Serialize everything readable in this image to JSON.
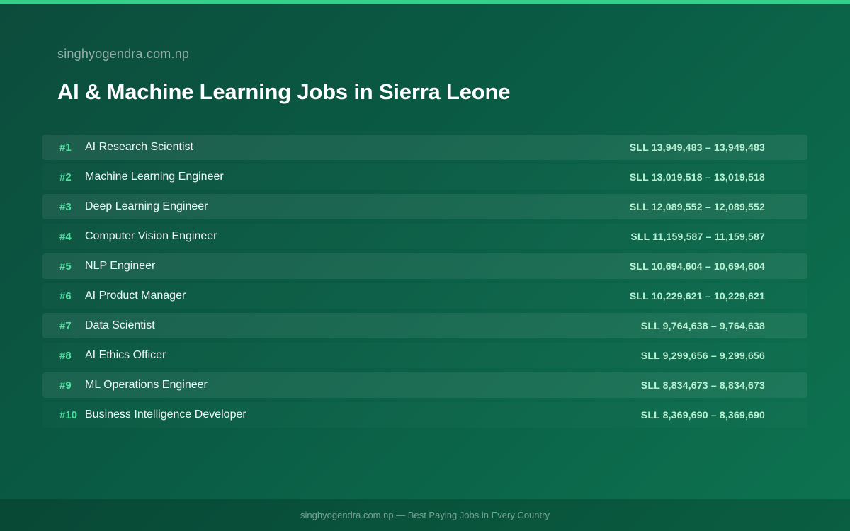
{
  "header": {
    "site_name": "singhyogendra.com.np",
    "title": "AI & Machine Learning Jobs in Sierra Leone"
  },
  "jobs": [
    {
      "rank": "#1",
      "title": "AI Research Scientist",
      "salary": "SLL 13,949,483 – 13,949,483"
    },
    {
      "rank": "#2",
      "title": "Machine Learning Engineer",
      "salary": "SLL 13,019,518 – 13,019,518"
    },
    {
      "rank": "#3",
      "title": "Deep Learning Engineer",
      "salary": "SLL 12,089,552 – 12,089,552"
    },
    {
      "rank": "#4",
      "title": "Computer Vision Engineer",
      "salary": "SLL 11,159,587 – 11,159,587"
    },
    {
      "rank": "#5",
      "title": "NLP Engineer",
      "salary": "SLL 10,694,604 – 10,694,604"
    },
    {
      "rank": "#6",
      "title": "AI Product Manager",
      "salary": "SLL 10,229,621 – 10,229,621"
    },
    {
      "rank": "#7",
      "title": "Data Scientist",
      "salary": "SLL 9,764,638 – 9,764,638"
    },
    {
      "rank": "#8",
      "title": "AI Ethics Officer",
      "salary": "SLL 9,299,656 – 9,299,656"
    },
    {
      "rank": "#9",
      "title": "ML Operations Engineer",
      "salary": "SLL 8,834,673 – 8,834,673"
    },
    {
      "rank": "#10",
      "title": "Business Intelligence Developer",
      "salary": "SLL 8,369,690 – 8,369,690"
    }
  ],
  "footer": {
    "text": "singhyogendra.com.np — Best Paying Jobs in Every Country"
  },
  "colors": {
    "accent": "#34d08a",
    "rank": "#4ee0a0",
    "salary": "#b8f0d4",
    "background_start": "#0c4c3c",
    "background_end": "#0d7350"
  }
}
